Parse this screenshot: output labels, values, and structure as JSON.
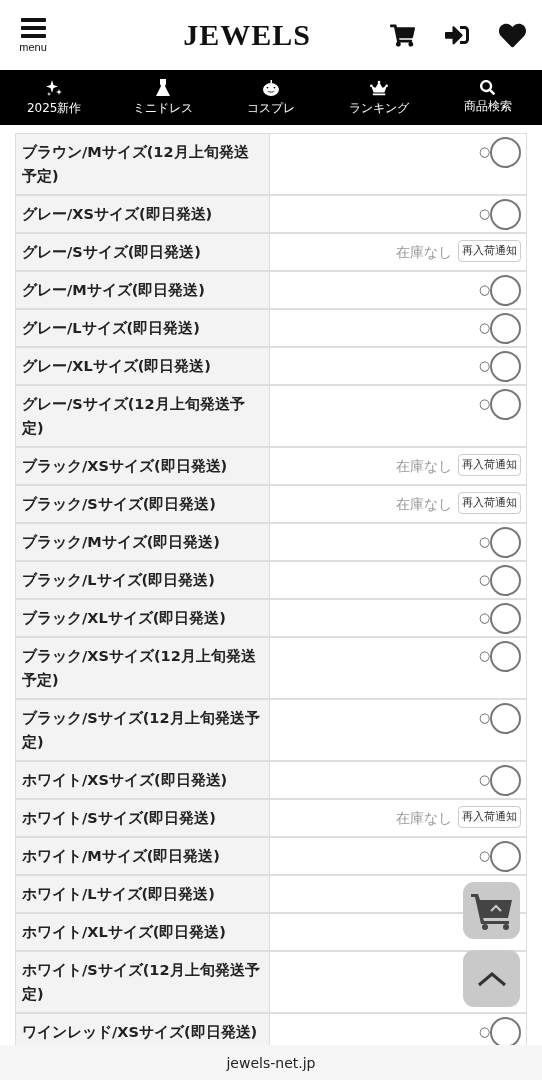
{
  "header": {
    "menu_label": "menu",
    "logo": "JEWELS"
  },
  "nav": [
    {
      "kind": "sparkles",
      "label": "2025新作"
    },
    {
      "kind": "dress",
      "label": "ミニドレス"
    },
    {
      "kind": "pumpkin",
      "label": "コスプレ"
    },
    {
      "kind": "crown",
      "label": "ランキング"
    },
    {
      "kind": "search",
      "label": "商品検索"
    }
  ],
  "variants": [
    {
      "label": "ブラウン/Mサイズ(12月上旬発送予定)",
      "kind": "available",
      "mark": "○",
      "selected": false
    },
    {
      "label": "グレー/XSサイズ(即日発送)",
      "kind": "available",
      "mark": "○",
      "selected": false
    },
    {
      "label": "グレー/Sサイズ(即日発送)",
      "kind": "soldout",
      "status": "在庫なし",
      "button": "再入荷通知"
    },
    {
      "label": "グレー/Mサイズ(即日発送)",
      "kind": "available",
      "mark": "○",
      "selected": false
    },
    {
      "label": "グレー/Lサイズ(即日発送)",
      "kind": "available",
      "mark": "○",
      "selected": false
    },
    {
      "label": "グレー/XLサイズ(即日発送)",
      "kind": "available",
      "mark": "○",
      "selected": false
    },
    {
      "label": "グレー/Sサイズ(12月上旬発送予定)",
      "kind": "available",
      "mark": "○",
      "selected": false
    },
    {
      "label": "ブラック/XSサイズ(即日発送)",
      "kind": "soldout",
      "status": "在庫なし",
      "button": "再入荷通知"
    },
    {
      "label": "ブラック/Sサイズ(即日発送)",
      "kind": "soldout",
      "status": "在庫なし",
      "button": "再入荷通知"
    },
    {
      "label": "ブラック/Mサイズ(即日発送)",
      "kind": "available",
      "mark": "○",
      "selected": false
    },
    {
      "label": "ブラック/Lサイズ(即日発送)",
      "kind": "available",
      "mark": "○",
      "selected": false
    },
    {
      "label": "ブラック/XLサイズ(即日発送)",
      "kind": "available",
      "mark": "○",
      "selected": false
    },
    {
      "label": "ブラック/XSサイズ(12月上旬発送予定)",
      "kind": "available",
      "mark": "○",
      "selected": false
    },
    {
      "label": "ブラック/Sサイズ(12月上旬発送予定)",
      "kind": "available",
      "mark": "○",
      "selected": false
    },
    {
      "label": "ホワイト/XSサイズ(即日発送)",
      "kind": "available",
      "mark": "○",
      "selected": false
    },
    {
      "label": "ホワイト/Sサイズ(即日発送)",
      "kind": "soldout",
      "status": "在庫なし",
      "button": "再入荷通知"
    },
    {
      "label": "ホワイト/Mサイズ(即日発送)",
      "kind": "available",
      "mark": "○",
      "selected": false
    },
    {
      "label": "ホワイト/Lサイズ(即日発送)",
      "kind": "available"
    },
    {
      "label": "ホワイト/XLサイズ(即日発送)",
      "kind": "available"
    },
    {
      "label": "ホワイト/Sサイズ(12月上旬発送予定)",
      "kind": "available"
    },
    {
      "label": "ワインレッド/XSサイズ(即日発送)",
      "kind": "available",
      "mark": "○",
      "selected": false
    }
  ],
  "footer": {
    "url": "jewels-net.jp"
  }
}
